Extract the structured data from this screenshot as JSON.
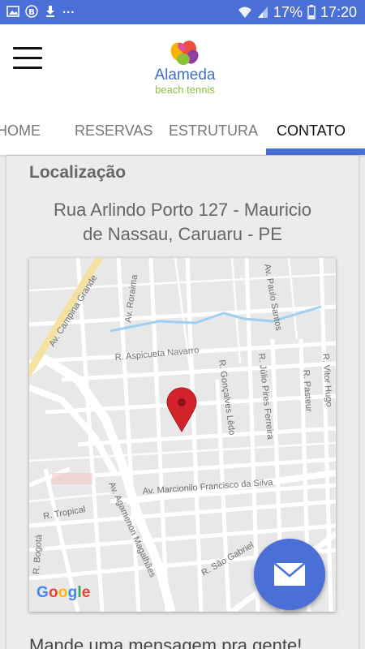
{
  "status_bar": {
    "battery": "17%",
    "time": "17:20",
    "dots": "...",
    "left_icons": [
      "image-icon",
      "b-badge-icon",
      "download-icon"
    ],
    "right_icons": [
      "wifi-icon",
      "signal-icon",
      "battery-icon"
    ]
  },
  "header": {
    "logo_name": "Alameda",
    "logo_sub": "beach tennis"
  },
  "tabs": [
    "HOME",
    "RESERVAS",
    "ESTRUTURA",
    "CONTATO"
  ],
  "active_tab": "CONTATO",
  "location": {
    "title": "Localização",
    "address_line1": "Rua Arlindo Porto 127 - Mauricio",
    "address_line2": "de Nassau, Caruaru - PE"
  },
  "map": {
    "streets": [
      "Av. Campina Grande",
      "Av. Roraima",
      "Av. Paulo Santos",
      "R. Aspicueta Navarro",
      "R. Gonçalves Lêdo",
      "R. Júlio Pires Ferreira",
      "R. Pasteur",
      "R. Vitor Hugo",
      "Av. Marcionilo Francisco da Silva",
      "Av. Agamenon Magalhães",
      "R. Tropical",
      "R. Bogotá",
      "R. São Gabriel"
    ],
    "attribution": "Google",
    "google_colors": [
      "#4285F4",
      "#EA4335",
      "#FBBC05",
      "#4285F4",
      "#34A853",
      "#EA4335"
    ]
  },
  "fab_icon": "mail-icon",
  "message_heading": "Mande uma mensagem pra gente!",
  "colors": {
    "primary": "#4a6fd6",
    "marker": "#d3232a",
    "logo_blue": "#3f6fc6",
    "logo_green": "#8bbf3c"
  }
}
